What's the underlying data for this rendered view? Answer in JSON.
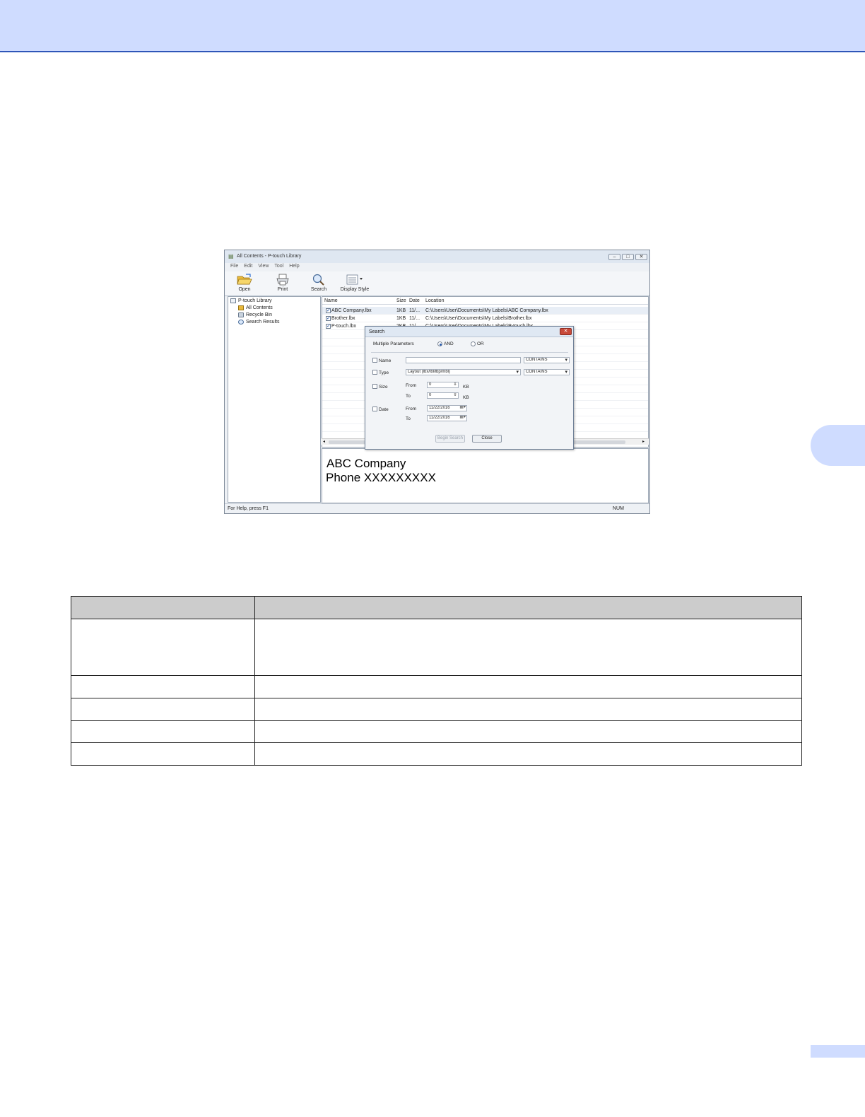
{
  "window": {
    "title": "All Contents - P-touch Library",
    "menu": [
      "File",
      "Edit",
      "View",
      "Tool",
      "Help"
    ],
    "toolbar": {
      "open": "Open",
      "print": "Print",
      "search": "Search",
      "display_style": "Display Style"
    },
    "tree": {
      "root": "P-touch Library",
      "items": [
        "All Contents",
        "Recycle Bin",
        "Search Results"
      ]
    },
    "list": {
      "columns": [
        "Name",
        "Size",
        "Date",
        "Location"
      ],
      "rows": [
        {
          "name": "ABC Company.lbx",
          "size": "1KB",
          "date": "11/...",
          "location": "C:\\Users\\User\\Documents\\My Labels\\ABC Company.lbx"
        },
        {
          "name": "Brother.lbx",
          "size": "1KB",
          "date": "11/...",
          "location": "C:\\Users\\User\\Documents\\My Labels\\Brother.lbx"
        },
        {
          "name": "P-touch.lbx",
          "size": "2KB",
          "date": "11/...",
          "location": "C:\\Users\\User\\Documents\\My Labels\\P-touch.lbx"
        }
      ]
    },
    "preview": {
      "line1": "ABC Company",
      "line2": "Phone XXXXXXXXX"
    },
    "status": {
      "help": "For Help, press F1",
      "num": "NUM"
    }
  },
  "dialog": {
    "title": "Search",
    "close_glyph": "✕",
    "multiple_parameters": "Multiple Parameters",
    "and_label": "AND",
    "or_label": "OR",
    "name_label": "Name",
    "name_value": "",
    "name_op": "CONTAINS",
    "type_label": "Type",
    "type_value": "Layout (lbx/lbl/lbp/mbl)",
    "type_op": "CONTAINS",
    "size_label": "Size",
    "size_from_label": "From",
    "size_from": "0",
    "size_to_label": "To",
    "size_to": "0",
    "size_unit": "KB",
    "date_label": "Date",
    "date_from_label": "From",
    "date_from": "11/22/2016",
    "date_to_label": "To",
    "date_to": "11/22/2016",
    "begin_search": "Begin Search",
    "close": "Close"
  },
  "colors": {
    "header_band": "#cfdcff",
    "header_rule": "#2f56b8",
    "table_header": "#cccccc"
  },
  "icons": {
    "title": "library-icon",
    "open": "folder-open-icon",
    "print": "printer-icon",
    "search": "magnifier-icon",
    "display_style": "list-view-icon"
  }
}
